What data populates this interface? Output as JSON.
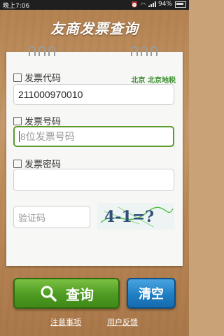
{
  "status_bar": {
    "time": "晚上7:06",
    "battery": "94%"
  },
  "header": {
    "title": "友商发票查询"
  },
  "form": {
    "invoice_code_label": "发票代码",
    "region": "北京 北京地税",
    "invoice_code_value": "211000970010",
    "invoice_number_label": "发票号码",
    "invoice_number_placeholder": "8位发票号码",
    "invoice_password_label": "发票密码",
    "invoice_password_value": "",
    "captcha_placeholder": "验证码",
    "captcha_image_text": "4-1=?"
  },
  "actions": {
    "query_label": "查询",
    "clear_label": "清空"
  },
  "footer": {
    "notes_link": "注意事项",
    "feedback_link": "用户反馈"
  },
  "colors": {
    "query_button": "#4e9a22",
    "clear_button": "#1f7fc3",
    "region_text": "#3b8f2e",
    "active_field_border": "#5a9b2b"
  }
}
